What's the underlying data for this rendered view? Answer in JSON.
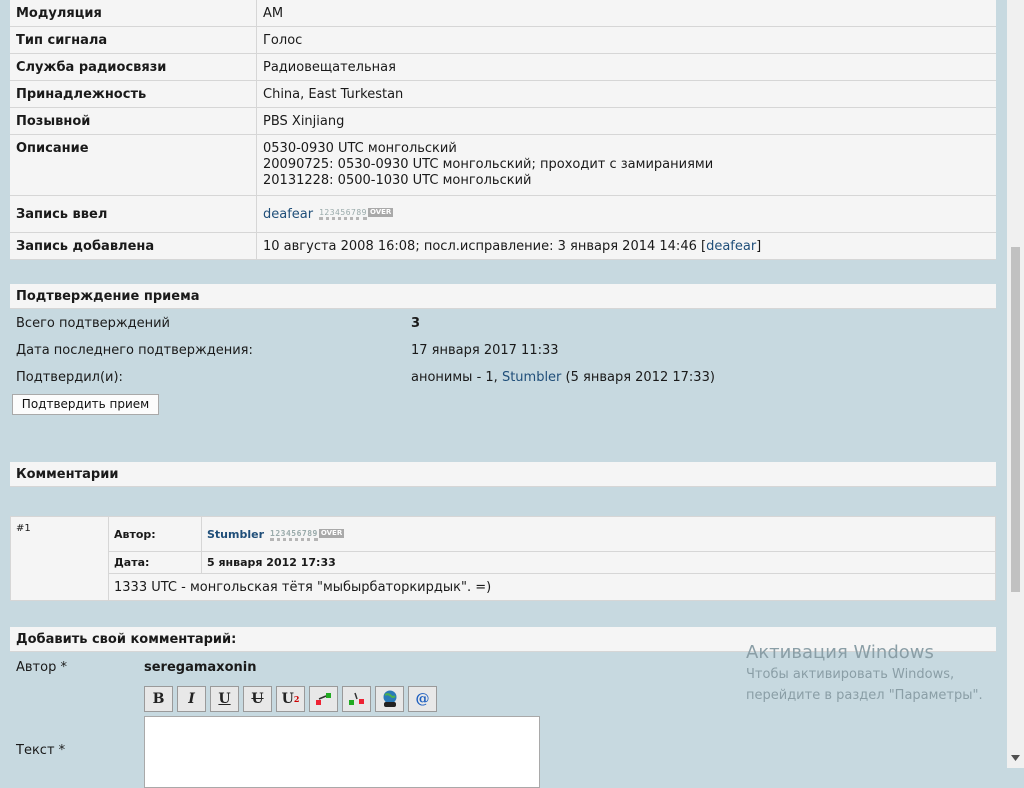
{
  "info": {
    "modulation": {
      "label": "Модуляция",
      "value": "AM"
    },
    "signal_type": {
      "label": "Тип сигнала",
      "value": "Голос"
    },
    "service": {
      "label": "Служба радиосвязи",
      "value": "Радиовещательная"
    },
    "owner": {
      "label": "Принадлежность",
      "value": "China, East Turkestan"
    },
    "callsign": {
      "label": "Позывной",
      "value": "PBS Xinjiang"
    },
    "description": {
      "label": "Описание",
      "lines": [
        "0530-0930 UTC монгольский",
        "20090725: 0530-0930 UTC монгольский; проходит с замираниями",
        "20131228: 0500-1030 UTC монгольский"
      ]
    },
    "entered_by": {
      "label": "Запись ввел",
      "user": "deafear"
    },
    "added": {
      "label": "Запись добавлена",
      "text": "10 августа 2008 16:08; посл.исправление: 3 января 2014 14:46 [",
      "user": "deafear",
      "close": "]"
    }
  },
  "rank_badge": {
    "digits": "123456789",
    "over": "OVER"
  },
  "confirmation": {
    "title": "Подтверждение приема",
    "total_label": "Всего подтверждений",
    "total_value": "3",
    "last_label": "Дата последнего подтверждения:",
    "last_value": "17 января 2017 11:33",
    "by_label": "Подтвердил(и):",
    "by_prefix": "анонимы - 1, ",
    "by_user": "Stumbler",
    "by_suffix": " (5 января 2012 17:33)",
    "button": "Подтвердить прием"
  },
  "comments": {
    "title": "Комментарии",
    "items": [
      {
        "num": "#1",
        "author_label": "Автор:",
        "author": "Stumbler",
        "date_label": "Дата:",
        "date": "5 января 2012 17:33",
        "text": "1333 UTC - монгольская тётя \"мыбырбаторкирдык\". =)"
      }
    ]
  },
  "add_comment": {
    "title": "Добавить свой комментарий:",
    "author_label": "Автор *",
    "author_value": "seregamaxonin",
    "text_label": "Текст *",
    "toolbar": [
      {
        "icon": "bold-icon",
        "glyph": "B"
      },
      {
        "icon": "italic-icon",
        "glyph": "I"
      },
      {
        "icon": "underline-icon",
        "glyph": "U"
      },
      {
        "icon": "strikethrough-icon",
        "glyph": "U"
      },
      {
        "icon": "superscript-icon",
        "glyph": "U"
      },
      {
        "icon": "insert-image-icon",
        "glyph": ""
      },
      {
        "icon": "insert-image-alt-icon",
        "glyph": ""
      },
      {
        "icon": "insert-link-globe-icon",
        "glyph": ""
      },
      {
        "icon": "insert-email-icon",
        "glyph": "@"
      }
    ]
  },
  "watermark": {
    "title": "Активация Windows",
    "line1": "Чтобы активировать Windows,",
    "line2": "перейдите в раздел \"Параметры\"."
  }
}
